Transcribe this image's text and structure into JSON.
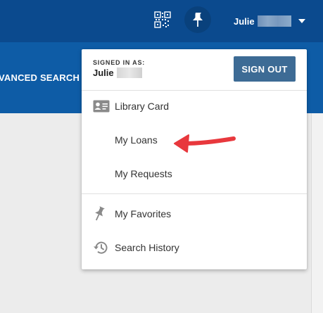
{
  "header": {
    "user_name": "Julie",
    "advanced_search_label": "VANCED SEARCH"
  },
  "menu": {
    "signed_in_label": "SIGNED IN AS:",
    "signed_in_name": "Julie",
    "sign_out_label": "SIGN OUT",
    "items": [
      {
        "label": "Library Card",
        "icon": "id-card-icon"
      },
      {
        "label": "My Loans",
        "icon": ""
      },
      {
        "label": "My Requests",
        "icon": ""
      },
      {
        "label": "My Favorites",
        "icon": "pin-icon"
      },
      {
        "label": "Search History",
        "icon": "history-icon"
      }
    ]
  },
  "colors": {
    "topbar": "#0b4a8e",
    "subbar": "#0e5ca6",
    "sign_out_button": "#3d6b95",
    "annotation_arrow": "#e8383d"
  }
}
